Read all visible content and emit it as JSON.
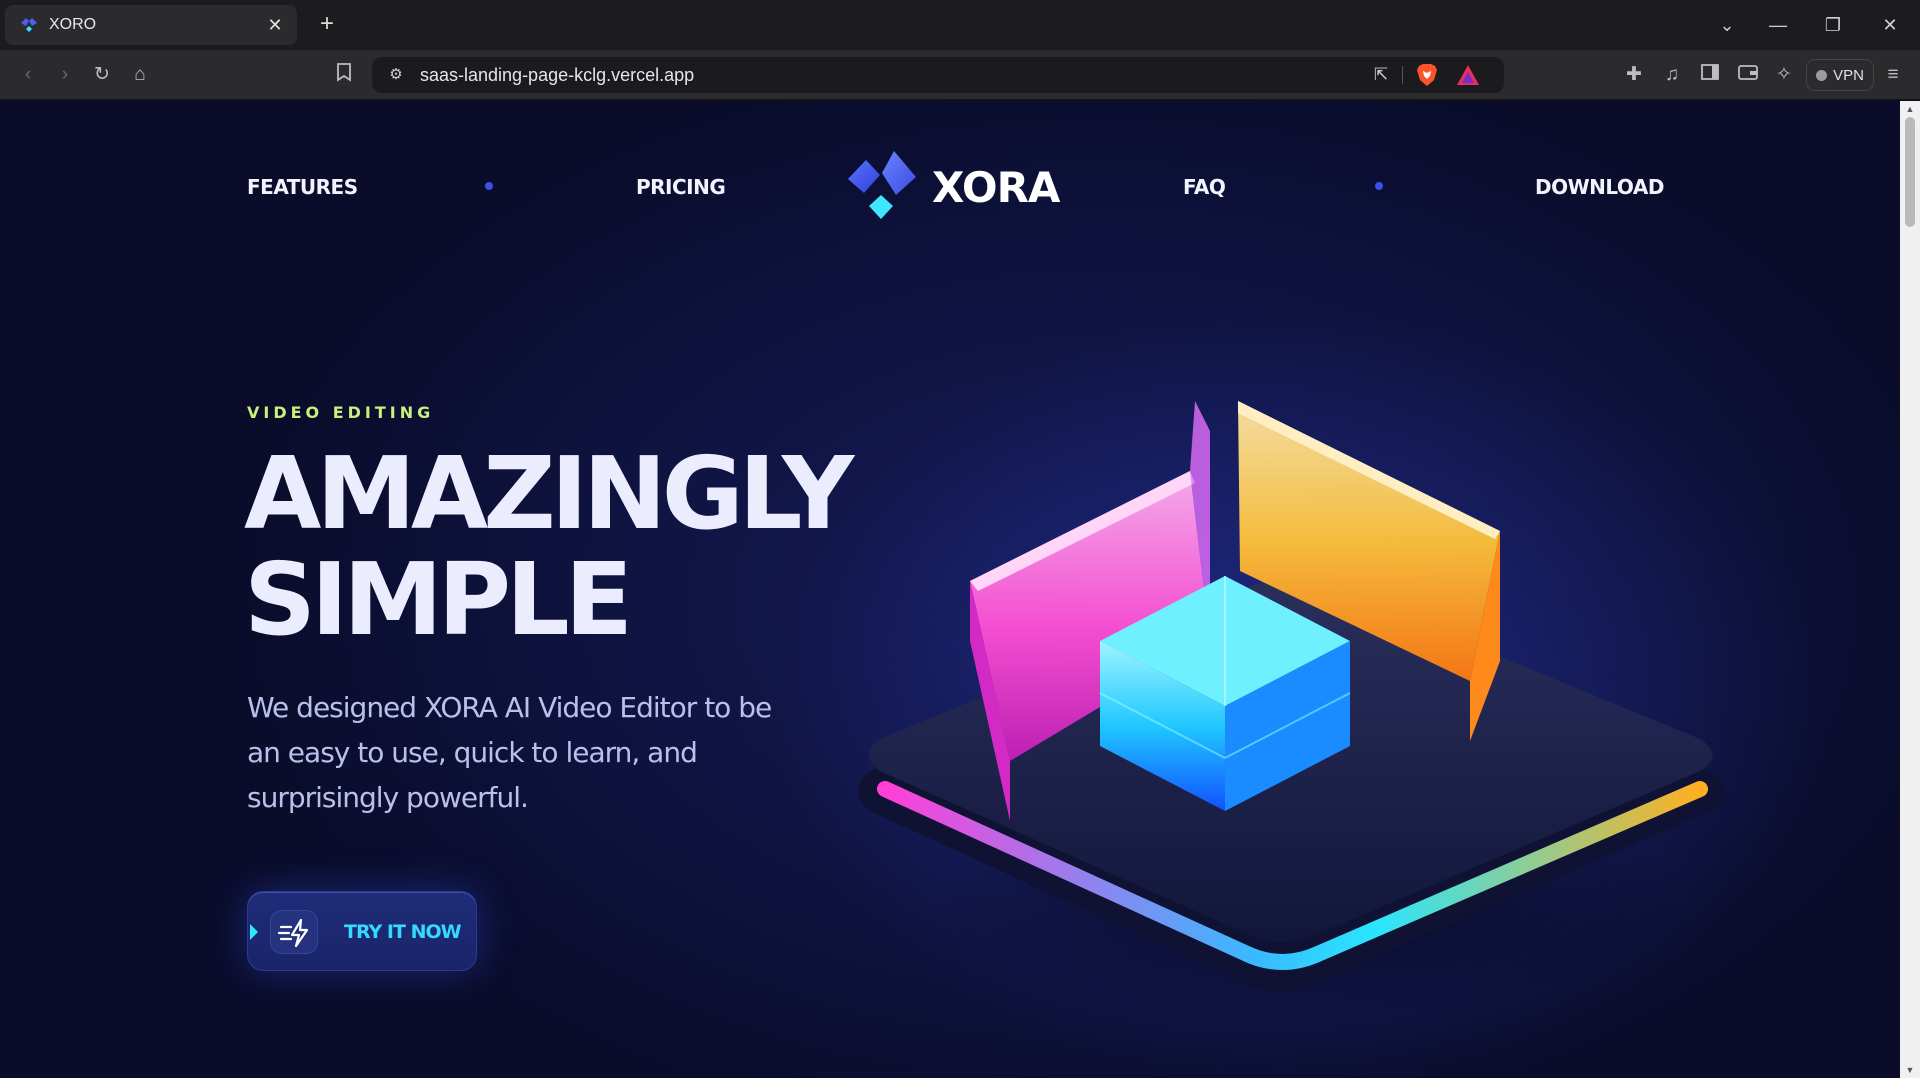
{
  "browser": {
    "tab_title": "XORO",
    "new_tab_symbol": "+",
    "close_symbol": "✕",
    "url": "saas-landing-page-kclg.vercel.app",
    "vpn_label": "VPN"
  },
  "nav": {
    "features": "FEATURES",
    "pricing": "PRICING",
    "logo_text": "XORA",
    "faq": "FAQ",
    "download": "DOWNLOAD"
  },
  "hero": {
    "eyebrow": "VIDEO EDITING",
    "headline_line1": "AMAZINGLY",
    "headline_line2": "SIMPLE",
    "lead_line1": "We designed XORA AI Video Editor to be",
    "lead_line2": "an easy to use, quick to learn, and",
    "lead_line3": "surprisingly powerful.",
    "cta_label": "TRY IT NOW"
  },
  "colors": {
    "accent_blue": "#3c52e6",
    "accent_cyan": "#33d9ff",
    "eyebrow_green": "#c9f07a",
    "background": "#0f1340"
  },
  "icons": [
    "back-icon",
    "forward-icon",
    "reload-icon",
    "home-icon",
    "bookmark-icon",
    "site-settings-icon",
    "share-icon",
    "brave-shield-icon",
    "brave-rewards-icon",
    "extensions-icon",
    "media-icon",
    "sidebar-icon",
    "wallet-icon",
    "leo-ai-icon",
    "menu-icon",
    "bolt-icon"
  ]
}
